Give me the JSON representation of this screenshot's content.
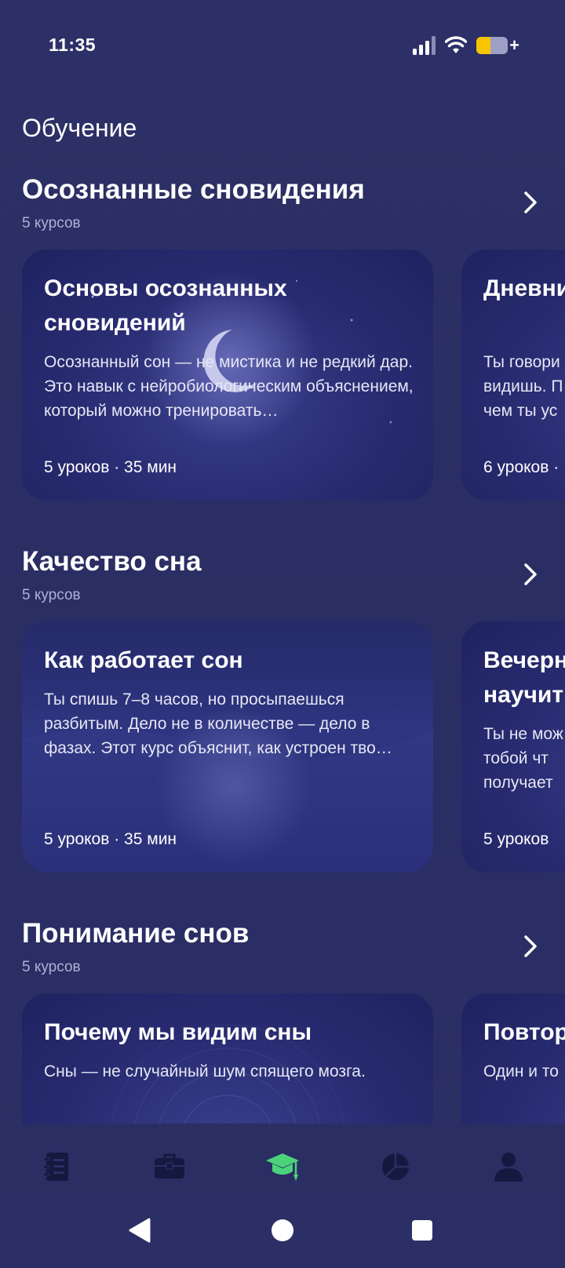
{
  "status_bar": {
    "time": "11:35",
    "battery_level": 0.45
  },
  "header": {
    "title": "Обучение"
  },
  "sections": [
    {
      "title": "Осознанные сновидения",
      "count": "5 курсов",
      "cards": [
        {
          "title": "Основы осознанных сновидений",
          "description": "Осознанный сон — не мистика и не редкий дар. Это навык с нейробиологическим объяснением, который можно тренировать…",
          "meta": "5 уроков · 35 мин"
        },
        {
          "title": "Дневник: что исч",
          "description": "Ты говори видишь. П чем ты ус",
          "meta": "6 уроков ·"
        }
      ]
    },
    {
      "title": "Качество сна",
      "count": "5 курсов",
      "cards": [
        {
          "title": "Как работает сон",
          "description": "Ты спишь 7–8 часов, но просыпаешься разбитым. Дело не в количестве — дело в фазах. Этот курс объяснит, как устроен тво…",
          "meta": "5 уроков · 35 мин"
        },
        {
          "title": "Вечерн научит",
          "description": "Ты не мож с тобой чт получает",
          "meta": "5 уроков"
        }
      ]
    },
    {
      "title": "Понимание снов",
      "count": "5 курсов",
      "cards": [
        {
          "title": "Почему мы видим сны",
          "description": "Сны — не случайный шум спящего мозга.",
          "meta": ""
        },
        {
          "title": "Повтор",
          "description": "Один и то",
          "meta": ""
        }
      ]
    }
  ],
  "nav": {
    "items": [
      {
        "icon": "journal-icon",
        "active": false
      },
      {
        "icon": "briefcase-icon",
        "active": false
      },
      {
        "icon": "graduation-cap-icon",
        "active": true
      },
      {
        "icon": "pie-chart-icon",
        "active": false
      },
      {
        "icon": "profile-icon",
        "active": false
      }
    ],
    "active_color": "#4cd37a",
    "inactive_color": "#15183f"
  }
}
